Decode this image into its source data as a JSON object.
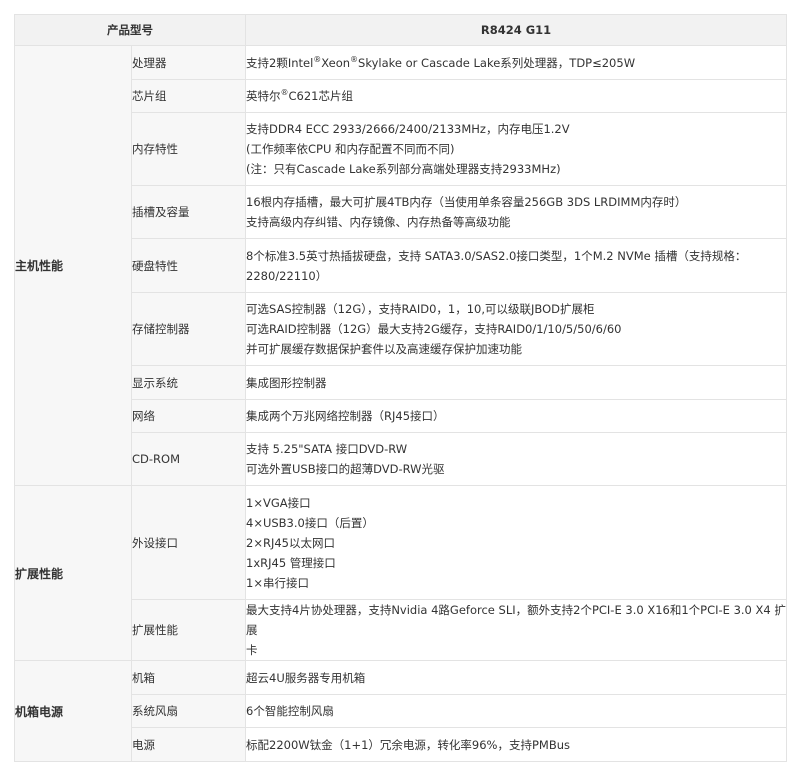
{
  "header": {
    "label": "产品型号",
    "model": "R8424 G11"
  },
  "sections": [
    {
      "category": "主机性能",
      "rows": [
        {
          "name": "处理器",
          "lines": [
            "支持2颗Intel®Xeon®Skylake or Cascade Lake系列处理器，TDP≤205W"
          ]
        },
        {
          "name": "芯片组",
          "lines": [
            "英特尔®C621芯片组"
          ]
        },
        {
          "name": "内存特性",
          "lines": [
            "支持DDR4 ECC 2933/2666/2400/2133MHz，内存电压1.2V",
            "(工作频率依CPU 和内存配置不同而不同)",
            "(注：只有Cascade Lake系列部分高端处理器支持2933MHz)"
          ]
        },
        {
          "name": "插槽及容量",
          "lines": [
            "16根内存插槽，最大可扩展4TB内存（当使用单条容量256GB 3DS LRDIMM内存时）",
            "支持高级内存纠错、内存镜像、内存热备等高级功能"
          ]
        },
        {
          "name": "硬盘特性",
          "lines": [
            "8个标准3.5英寸热插拔硬盘，支持 SATA3.0/SAS2.0接口类型，1个M.2 NVMe 插槽（支持规格：",
            "2280/22110）"
          ]
        },
        {
          "name": "存储控制器",
          "lines": [
            "可选SAS控制器（12G），支持RAID0，1，10,可以级联JBOD扩展柜",
            "可选RAID控制器（12G）最大支持2G缓存，支持RAID0/1/10/5/50/6/60",
            "并可扩展缓存数据保护套件以及高速缓存保护加速功能"
          ]
        },
        {
          "name": "显示系统",
          "lines": [
            "集成图形控制器"
          ]
        },
        {
          "name": "网络",
          "lines": [
            "集成两个万兆网络控制器（RJ45接口）"
          ]
        },
        {
          "name": "CD-ROM",
          "lines": [
            "支持 5.25\"SATA 接口DVD-RW",
            "可选外置USB接口的超薄DVD-RW光驱"
          ]
        }
      ]
    },
    {
      "category": "扩展性能",
      "rows": [
        {
          "name": "外设接口",
          "lines": [
            "1×VGA接口",
            "4×USB3.0接口（后置）",
            "2×RJ45以太网口",
            "1xRJ45 管理接口",
            "1×串行接口"
          ]
        },
        {
          "name": "扩展性能",
          "lines": [
            "最大支持4片协处理器，支持Nvidia 4路Geforce SLI，额外支持2个PCI-E 3.0 X16和1个PCI-E 3.0 X4 扩展",
            "卡"
          ]
        }
      ]
    },
    {
      "category": "机箱电源",
      "rows": [
        {
          "name": "机箱",
          "lines": [
            "超云4U服务器专用机箱"
          ]
        },
        {
          "name": "系统风扇",
          "lines": [
            "6个智能控制风扇"
          ]
        },
        {
          "name": "电源",
          "lines": [
            "标配2200W钛金（1+1）冗余电源，转化率96%，支持PMBus"
          ]
        }
      ]
    }
  ]
}
